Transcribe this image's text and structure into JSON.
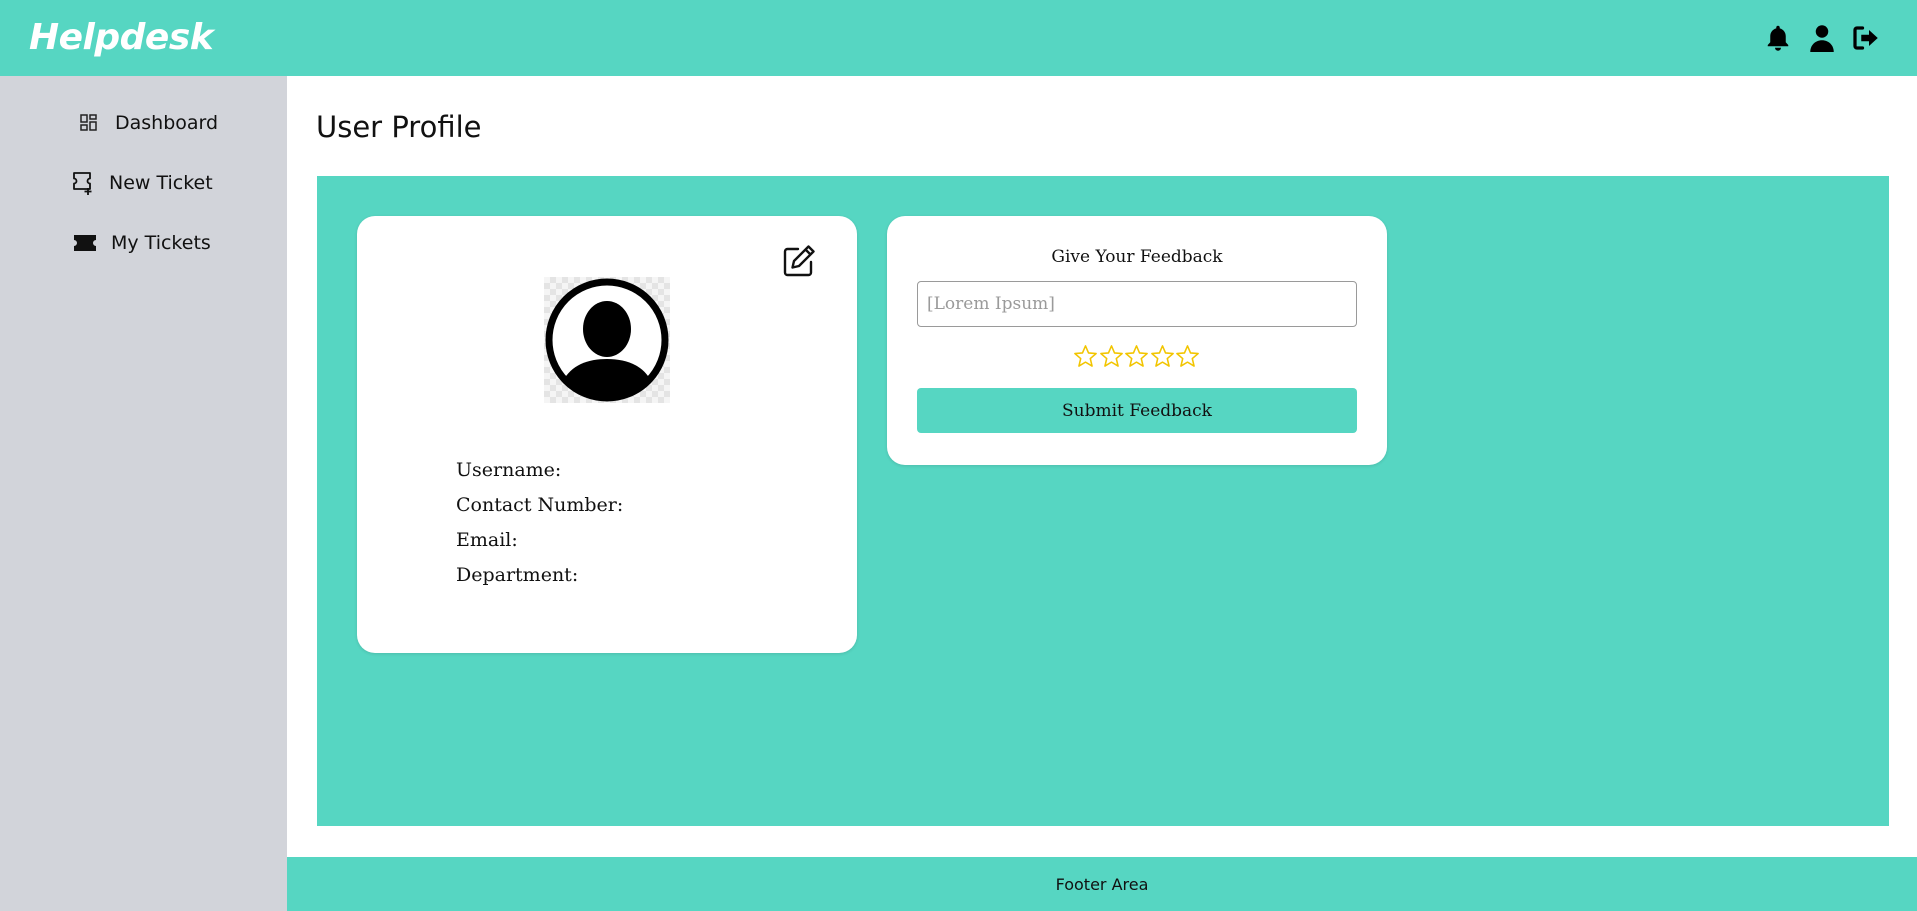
{
  "header": {
    "brand": "Helpdesk",
    "icons": [
      "bell-icon",
      "user-icon",
      "logout-icon"
    ]
  },
  "sidebar": {
    "items": [
      {
        "label": "Dashboard",
        "icon": "dashboard-grid-icon"
      },
      {
        "label": "New Ticket",
        "icon": "new-ticket-icon"
      },
      {
        "label": "My Tickets",
        "icon": "ticket-icon"
      }
    ]
  },
  "main": {
    "title": "User Profile"
  },
  "profile": {
    "avatar_icon": "user-avatar-icon",
    "edit_icon": "edit-icon",
    "fields": [
      {
        "label": "Username:",
        "value": ""
      },
      {
        "label": "Contact Number:",
        "value": ""
      },
      {
        "label": "Email:",
        "value": ""
      },
      {
        "label": "Department:",
        "value": ""
      }
    ]
  },
  "feedback": {
    "title": "Give Your Feedback",
    "placeholder": "[Lorem Ipsum]",
    "value": "",
    "rating": 0,
    "max_rating": 5,
    "submit_label": "Submit Feedback"
  },
  "footer": {
    "text": "Footer Area"
  },
  "colors": {
    "accent": "#56d6c2",
    "sidebar_bg": "#d2d4da",
    "star": "#f2c500"
  }
}
